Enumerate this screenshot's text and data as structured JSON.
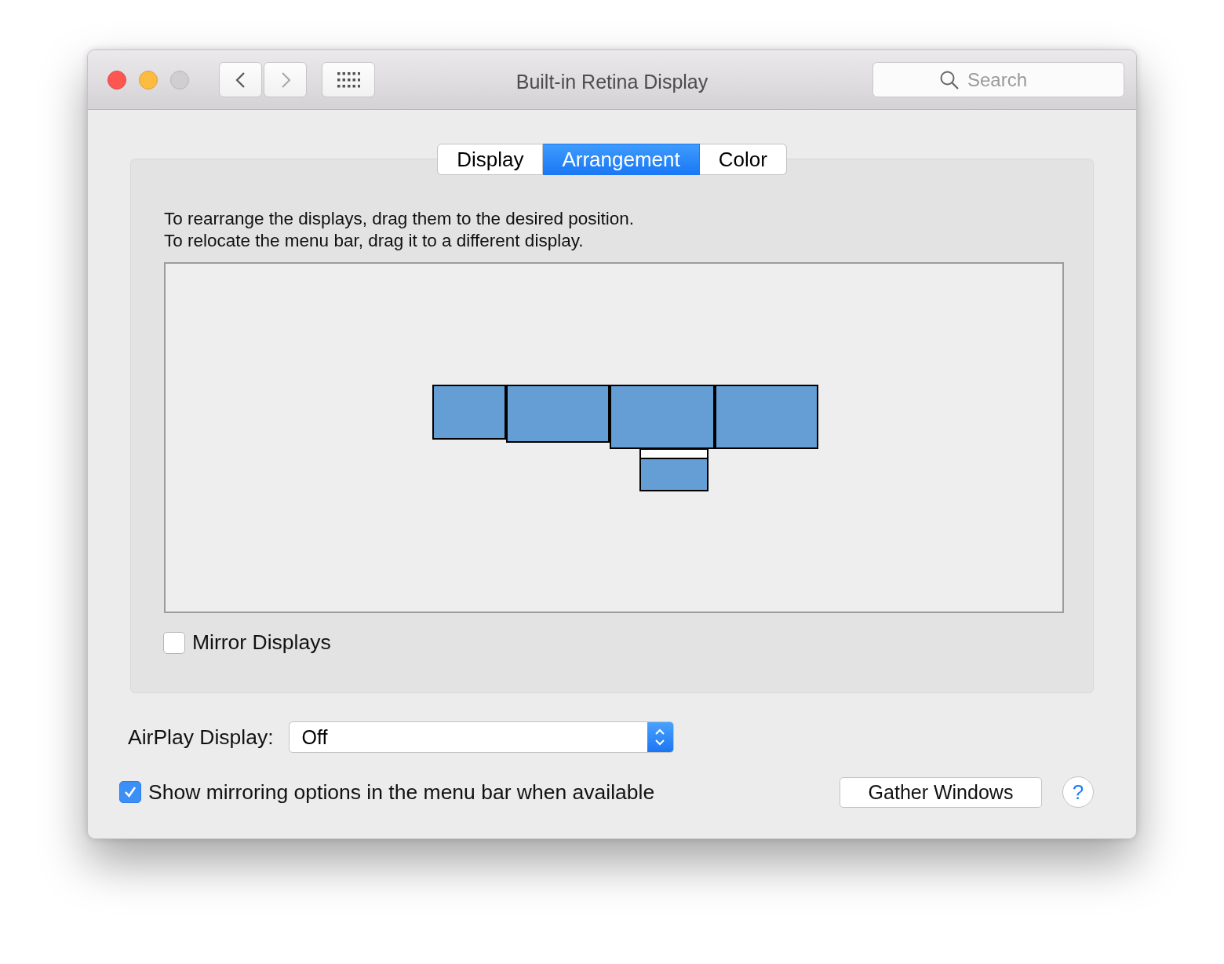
{
  "window": {
    "title": "Built-in Retina Display"
  },
  "search": {
    "placeholder": "Search"
  },
  "tabs": [
    {
      "label": "Display",
      "selected": false
    },
    {
      "label": "Arrangement",
      "selected": true
    },
    {
      "label": "Color",
      "selected": false
    }
  ],
  "instructions": [
    "To rearrange the displays, drag them to the desired position.",
    "To relocate the menu bar, drag it to a different display."
  ],
  "mirror_displays": {
    "label": "Mirror Displays",
    "checked": false
  },
  "airplay": {
    "label": "AirPlay Display:",
    "value": "Off"
  },
  "show_mirroring": {
    "label": "Show mirroring options in the menu bar when available",
    "checked": true
  },
  "gather_button": "Gather Windows",
  "help_button": "?"
}
